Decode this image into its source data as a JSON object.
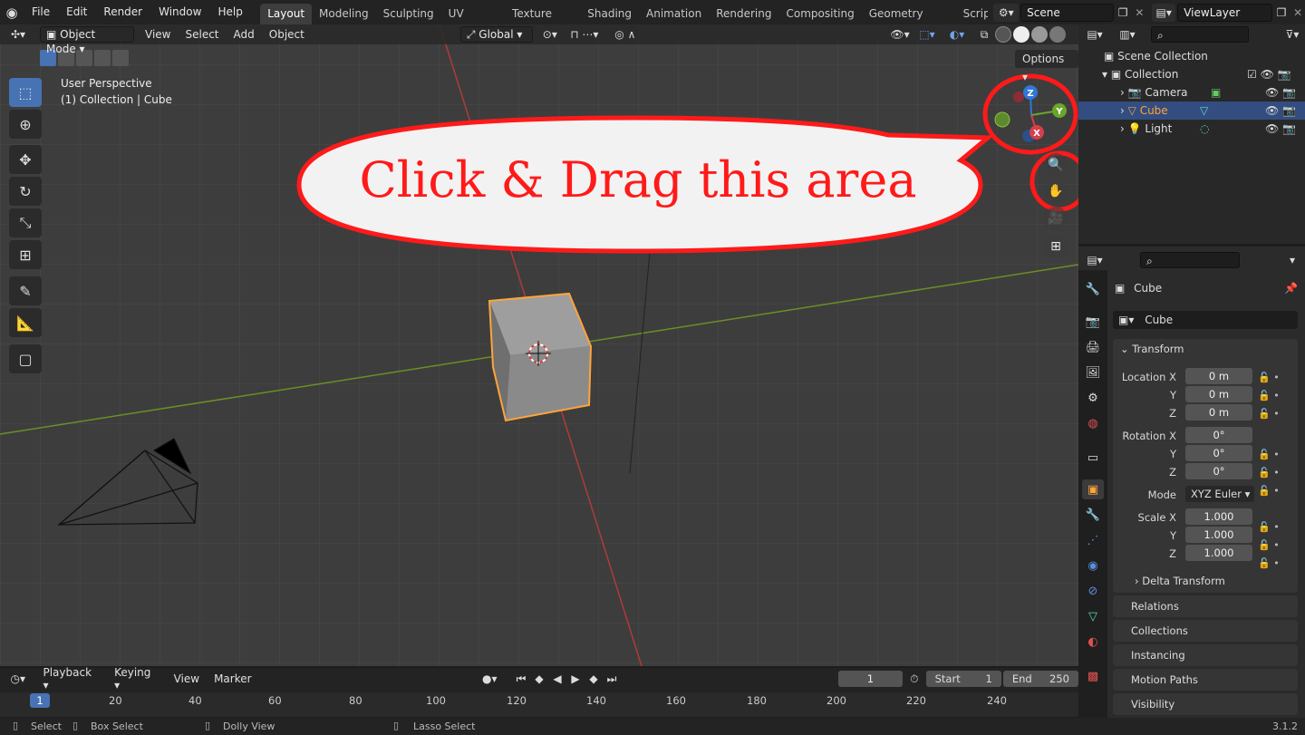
{
  "topbar": {
    "menus": [
      "File",
      "Edit",
      "Render",
      "Window",
      "Help"
    ],
    "workspaces": [
      "Layout",
      "Modeling",
      "Sculpting",
      "UV Editing",
      "Texture Paint",
      "Shading",
      "Animation",
      "Rendering",
      "Compositing",
      "Geometry Nodes",
      "Scripting"
    ],
    "active_workspace": "Layout",
    "scene": "Scene",
    "view_layer": "ViewLayer"
  },
  "viewport_header": {
    "mode": "Object Mode",
    "menus": [
      "View",
      "Select",
      "Add",
      "Object"
    ],
    "transform": "Global",
    "options": "Options"
  },
  "overlay": {
    "perspective": "User Perspective",
    "collection": "(1) Collection | Cube"
  },
  "callout": {
    "text": "Click & Drag this area"
  },
  "gizmo": {
    "z": "Z",
    "y": "Y",
    "x": "X"
  },
  "outliner": {
    "root": "Scene Collection",
    "collection": "Collection",
    "items": [
      "Camera",
      "Cube",
      "Light"
    ],
    "selected": "Cube"
  },
  "properties": {
    "object_name": "Cube",
    "data_name": "Cube",
    "transform_label": "Transform",
    "location_label": "Location X",
    "rotation_label": "Rotation X",
    "scale_label": "Scale X",
    "y": "Y",
    "z": "Z",
    "location": [
      "0 m",
      "0 m",
      "0 m"
    ],
    "rotation": [
      "0°",
      "0°",
      "0°"
    ],
    "mode_label": "Mode",
    "mode": "XYZ Euler",
    "scale": [
      "1.000",
      "1.000",
      "1.000"
    ],
    "delta": "Delta Transform",
    "panels": [
      "Relations",
      "Collections",
      "Instancing",
      "Motion Paths",
      "Visibility"
    ]
  },
  "timeline": {
    "menus": [
      "Playback",
      "Keying",
      "View",
      "Marker"
    ],
    "current_frame": "1",
    "start_label": "Start",
    "start": "1",
    "end_label": "End",
    "end": "250",
    "ticks": [
      "1",
      "20",
      "40",
      "60",
      "80",
      "100",
      "120",
      "140",
      "160",
      "180",
      "200",
      "220",
      "240"
    ]
  },
  "statusbar": {
    "select": "Select",
    "box_select": "Box Select",
    "dolly": "Dolly View",
    "lasso": "Lasso Select",
    "version": "3.1.2"
  },
  "colors": {
    "accent": "#4772b3",
    "selection": "#ffa43a",
    "callout": "#ff1a1a"
  }
}
